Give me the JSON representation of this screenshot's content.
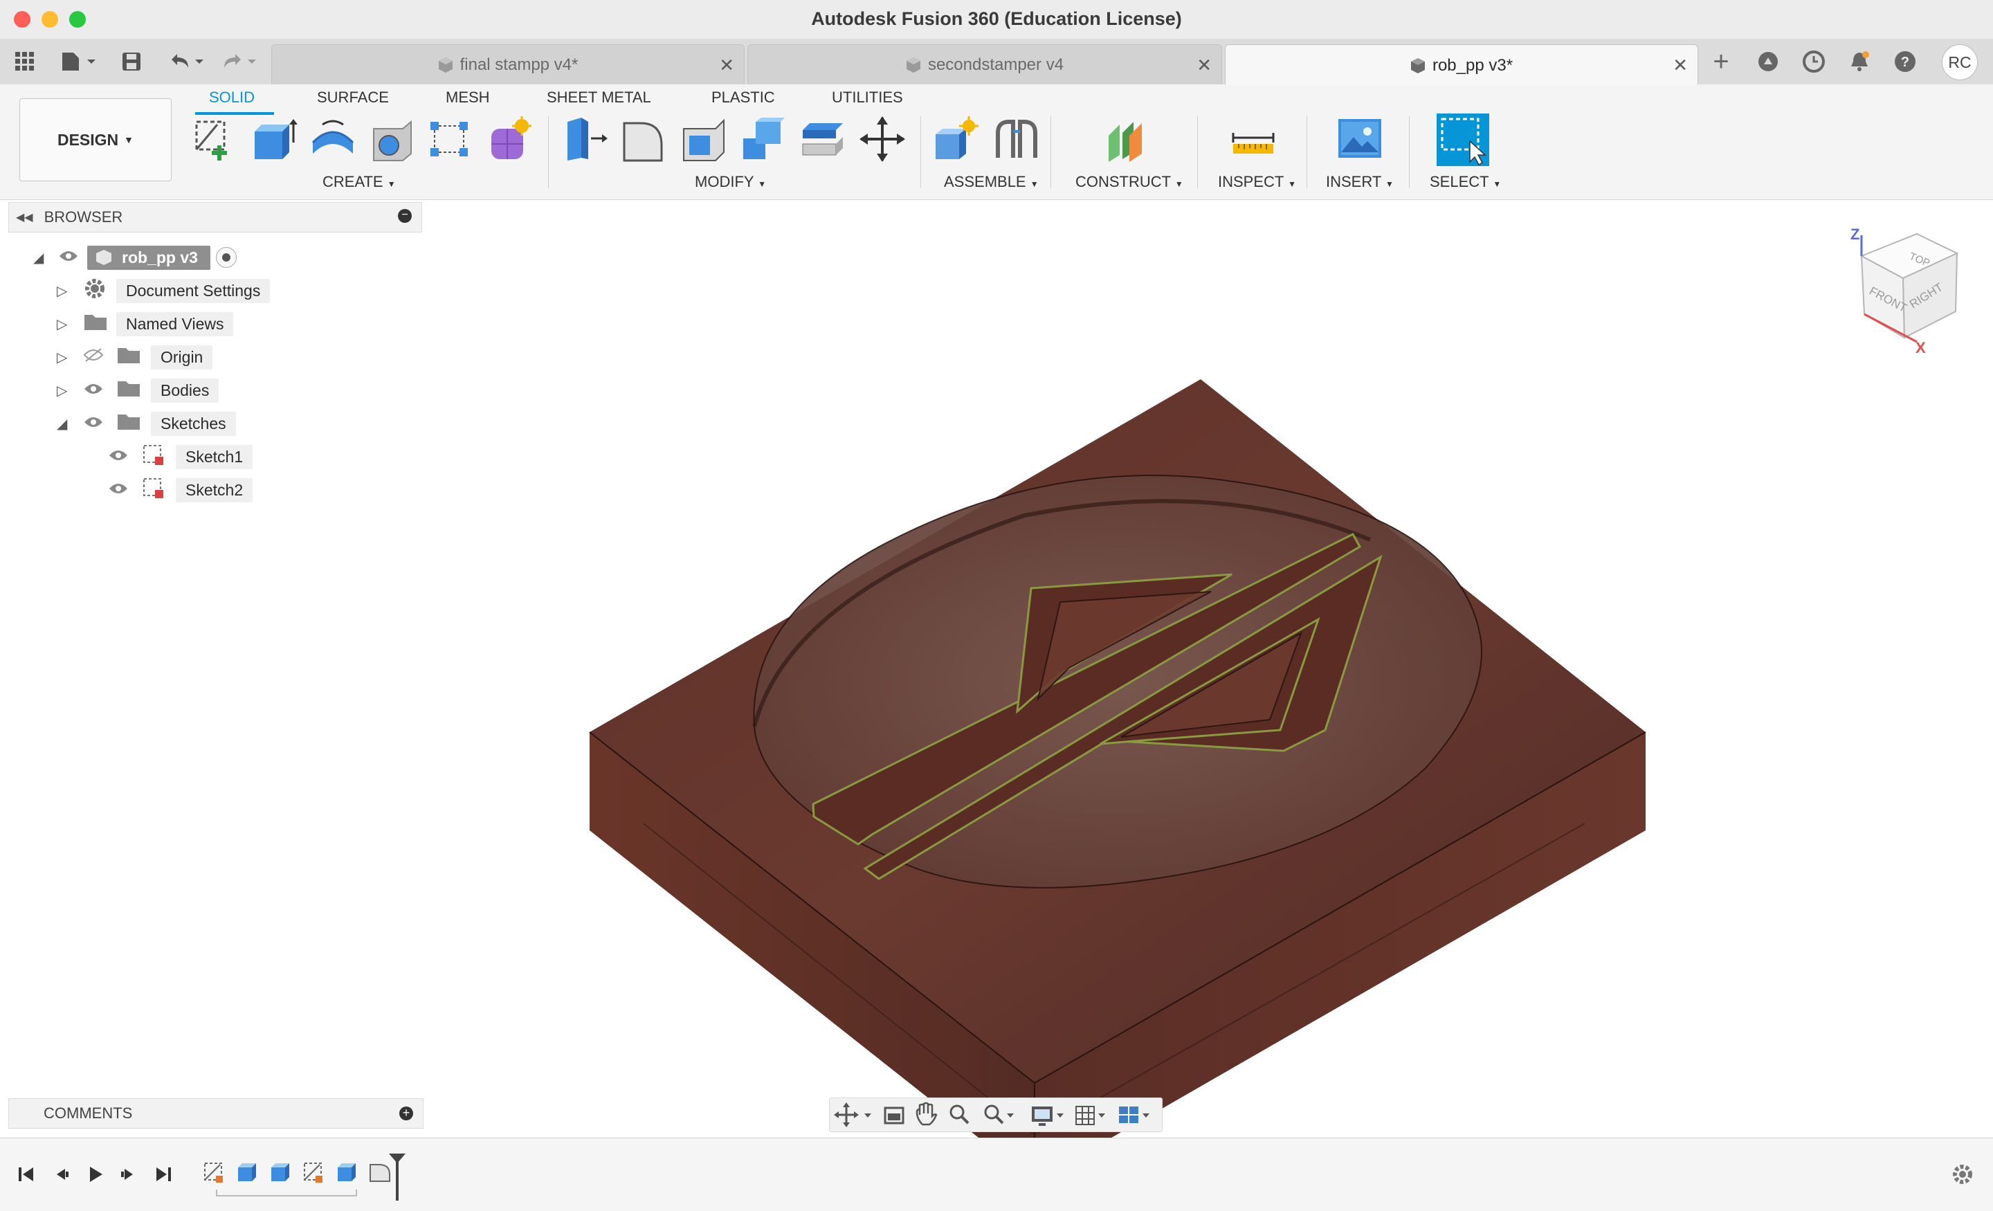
{
  "window": {
    "title": "Autodesk Fusion 360 (Education License)"
  },
  "tabs": [
    {
      "label": "final stampp v4*"
    },
    {
      "label": "secondstamper v4"
    },
    {
      "label": "rob_pp v3*"
    }
  ],
  "account": {
    "initials": "RC"
  },
  "workspace": {
    "label": "DESIGN"
  },
  "ribbon_tabs": [
    "SOLID",
    "SURFACE",
    "MESH",
    "SHEET METAL",
    "PLASTIC",
    "UTILITIES"
  ],
  "groups": {
    "create": "CREATE",
    "modify": "MODIFY",
    "assemble": "ASSEMBLE",
    "construct": "CONSTRUCT",
    "inspect": "INSPECT",
    "insert": "INSERT",
    "select": "SELECT"
  },
  "browser": {
    "title": "BROWSER",
    "root": "rob_pp v3",
    "nodes": [
      "Document Settings",
      "Named Views",
      "Origin",
      "Bodies",
      "Sketches"
    ],
    "sketches": [
      "Sketch1",
      "Sketch2"
    ]
  },
  "comments": {
    "title": "COMMENTS"
  },
  "viewcube": {
    "top": "TOP",
    "front": "FRONT",
    "right": "RIGHT",
    "axis_z": "Z",
    "axis_x": "X"
  },
  "colors": {
    "accent": "#0696d7",
    "wood": "#5b2e26",
    "select": "#0696d7"
  }
}
